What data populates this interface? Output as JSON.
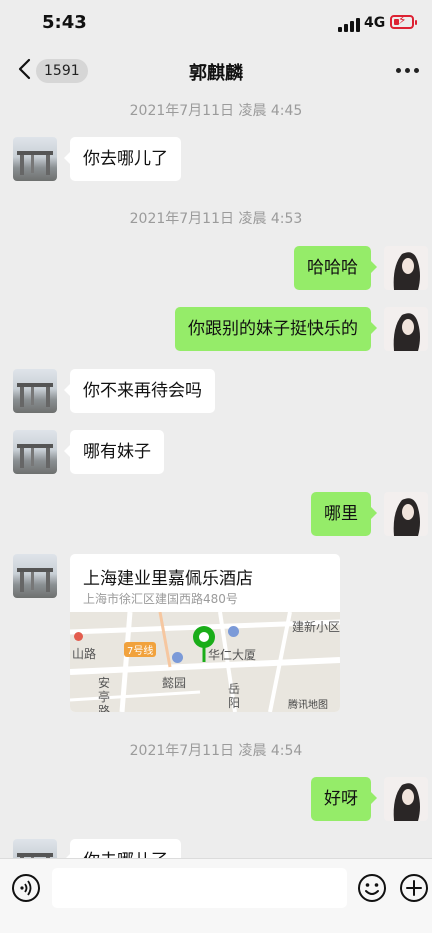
{
  "status_bar": {
    "time": "5:43",
    "network": "4G"
  },
  "header": {
    "unread_count": "1591",
    "title": "郭麒麟"
  },
  "messages": [
    {
      "timestamp": "2021年7月11日 凌晨 4:45"
    },
    {
      "text": "你去哪儿了"
    },
    {
      "timestamp": "2021年7月11日 凌晨 4:53"
    },
    {
      "text": "哈哈哈"
    },
    {
      "text": "你跟别的妹子挺快乐的"
    },
    {
      "text": "你不来再待会吗"
    },
    {
      "text": "哪有妹子"
    },
    {
      "text": "哪里"
    },
    {
      "location": {
        "name": "上海建业里嘉佩乐酒店",
        "address": "上海市徐汇区建国西路480号",
        "map_labels": [
          "山路",
          "7号线",
          "华仁大厦",
          "建新小区",
          "安亭路",
          "懿园",
          "岳阳",
          "腾讯地图"
        ]
      }
    },
    {
      "timestamp": "2021年7月11日 凌晨 4:54"
    },
    {
      "text": "好呀"
    },
    {
      "text": "你去哪儿了"
    }
  ],
  "input": {
    "placeholder": ""
  },
  "colors": {
    "background": "#ededed",
    "sent_bubble": "#95ec69",
    "received_bubble": "#ffffff",
    "map_pin": "#1aad19"
  }
}
